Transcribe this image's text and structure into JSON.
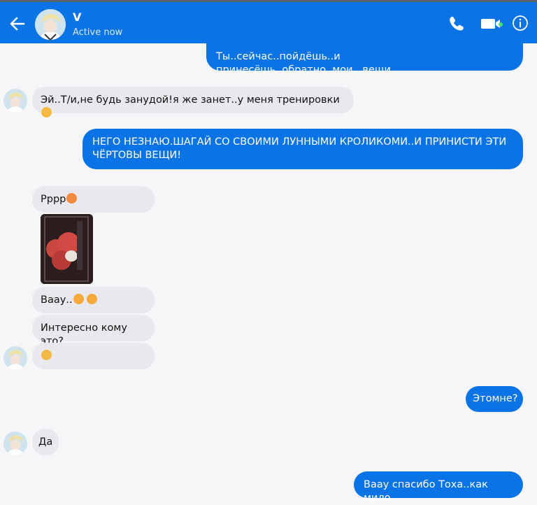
{
  "header": {
    "contact_name": "V",
    "status": "Active now"
  },
  "messages": [
    {
      "side": "out",
      "text": "Ты..сейчас..пойдёшь..и принесёшь..обратно..мои...вещи"
    },
    {
      "side": "in",
      "text": "Эй..Т/и,не будь занудой!я же занет..у меня тренировки",
      "emoji": "smiling-face"
    },
    {
      "side": "out",
      "text": "НЕГО НЕЗНАЮ.ШАГАЙ СО СВОИМИ ЛУННЫМИ КРОЛИКОМИ..И ПРИНИСТИ ЭТИ ЧЁРТОВЫ ВЕЩИ!"
    },
    {
      "side": "in",
      "text": "Рррр",
      "emoji": "pouting-face"
    },
    {
      "side": "in",
      "type": "photo"
    },
    {
      "side": "in",
      "text": "Ваау..",
      "emoji": "heart-eyes-face"
    },
    {
      "side": "in",
      "text": "Интересно кому это?"
    },
    {
      "side": "in",
      "emoji": "smirking-face"
    },
    {
      "side": "out",
      "text": "Этомне?"
    },
    {
      "side": "in",
      "text": "Да"
    },
    {
      "side": "out",
      "text": "Ваау спасибо Тоха..как мило"
    }
  ],
  "colors": {
    "accent": "#0a73e6",
    "incoming_bubble": "#e9e9ed",
    "background": "#f6f6f8",
    "online_dot": "#44e37a"
  }
}
